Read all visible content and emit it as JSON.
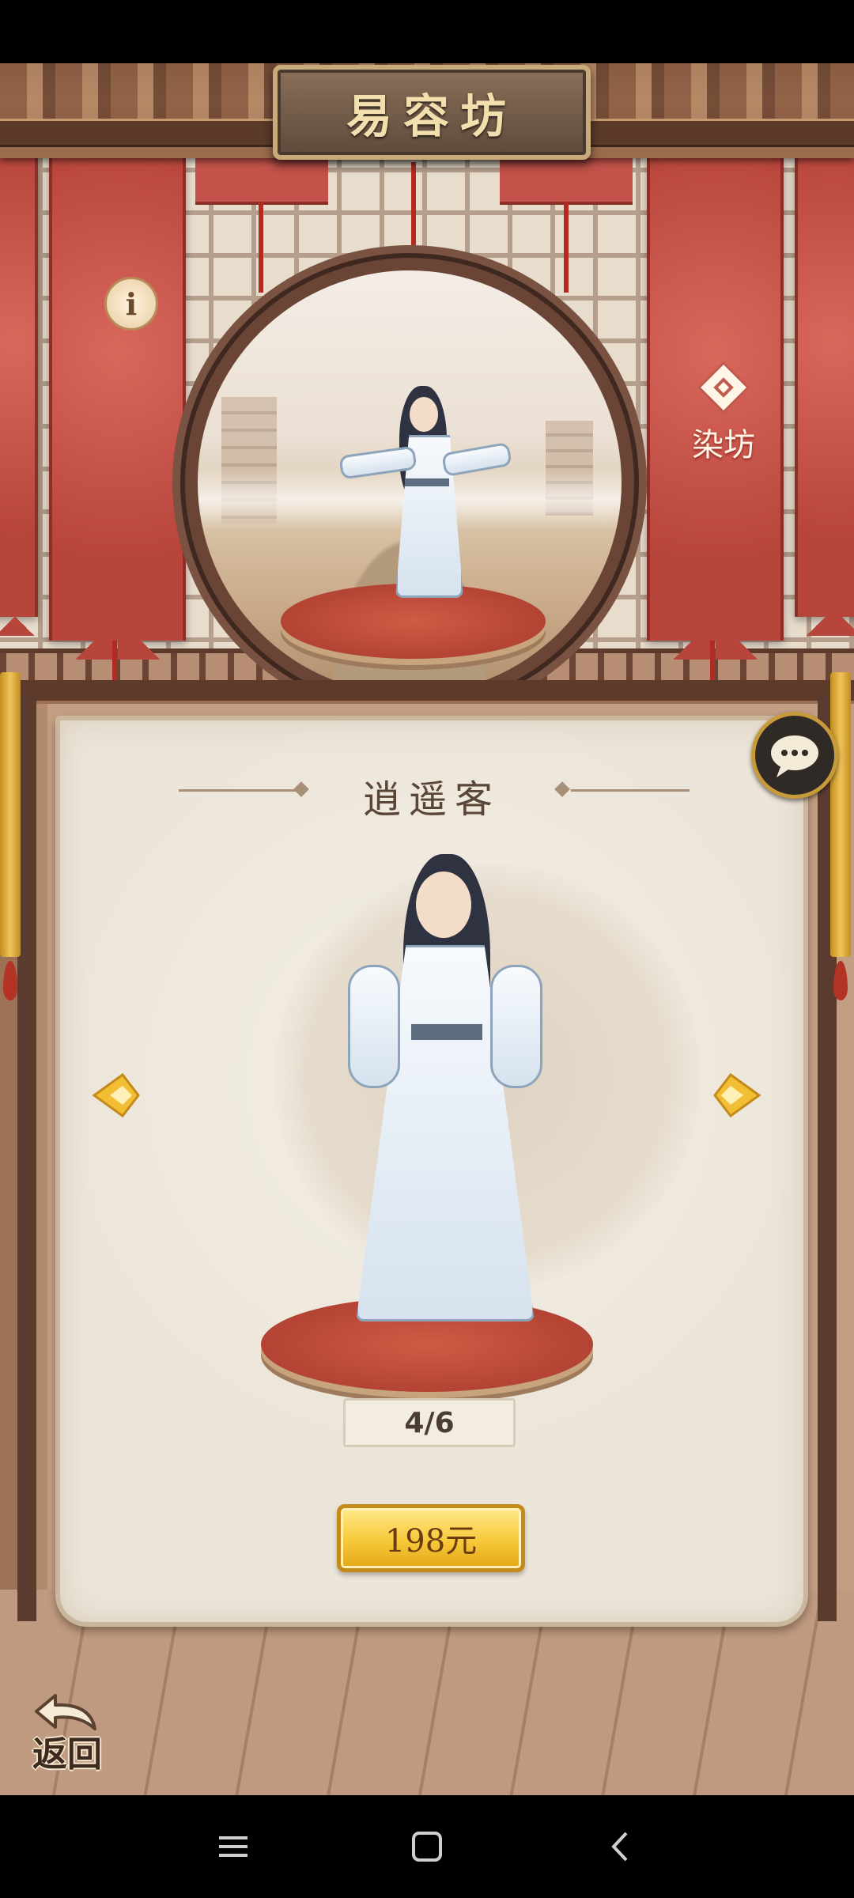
{
  "header": {
    "title": "易容坊"
  },
  "showcase": {
    "info_icon": "info-icon",
    "info_glyph": "i",
    "dye_shop": {
      "icon": "dye-diamond-icon",
      "label": "染坊"
    }
  },
  "panel": {
    "skin_name": "逍遥客",
    "counter": "4/6",
    "price_label": "198元",
    "chat_icon": "chat-bubble-icon",
    "prev_icon": "left-arrow-icon",
    "next_icon": "right-arrow-icon"
  },
  "footer": {
    "back_label": "返回",
    "back_icon": "back-arrow-icon"
  },
  "system_nav": {
    "menu_icon": "menu-icon",
    "home_icon": "home-icon",
    "back_icon": "back-icon"
  },
  "colors": {
    "banner_red": "#c2524a",
    "gold": "#f7c93a",
    "wood": "#5e3a2b",
    "scroll": "#ece5d9"
  }
}
